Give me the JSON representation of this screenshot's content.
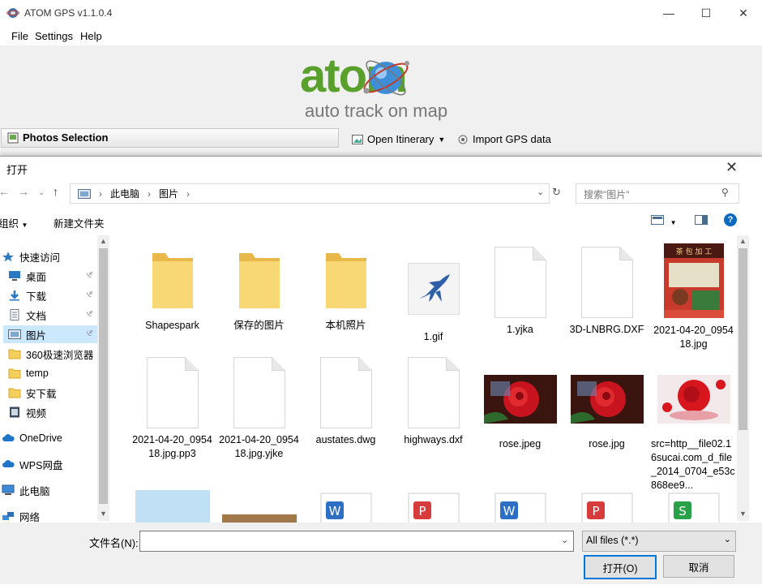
{
  "app": {
    "title": "ATOM GPS v1.1.0.4",
    "menu": [
      "File",
      "Settings",
      "Help"
    ],
    "logo_main": "atom",
    "logo_sub": "auto track on map",
    "panel_title": "Photos Selection",
    "toolbar": {
      "open_itinerary": "Open Itinerary",
      "import_gps": "Import GPS data"
    }
  },
  "dialog": {
    "title": "打开",
    "breadcrumbs": [
      "此电脑",
      "图片"
    ],
    "search_placeholder": "搜索\"图片\"",
    "organize": "组织",
    "new_folder": "新建文件夹",
    "nav": [
      {
        "label": "快速访问",
        "icon": "star-icon"
      },
      {
        "label": "桌面",
        "icon": "desktop-icon",
        "pinned": true
      },
      {
        "label": "下载",
        "icon": "download-icon",
        "pinned": true
      },
      {
        "label": "文档",
        "icon": "document-icon",
        "pinned": true
      },
      {
        "label": "图片",
        "icon": "pictures-icon",
        "pinned": true,
        "selected": true
      },
      {
        "label": "360极速浏览器",
        "icon": "folder-icon"
      },
      {
        "label": "temp",
        "icon": "folder-icon"
      },
      {
        "label": "安下载",
        "icon": "folder-icon"
      },
      {
        "label": "视频",
        "icon": "video-icon"
      },
      {
        "label": "OneDrive",
        "icon": "cloud-icon"
      },
      {
        "label": "WPS网盘",
        "icon": "cloud-icon"
      },
      {
        "label": "此电脑",
        "icon": "computer-icon"
      },
      {
        "label": "网络",
        "icon": "network-icon"
      }
    ],
    "files": [
      {
        "name": "Shapespark",
        "kind": "folder"
      },
      {
        "name": "保存的图片",
        "kind": "folder"
      },
      {
        "name": "本机照片",
        "kind": "folder"
      },
      {
        "name": "1.gif",
        "kind": "gif"
      },
      {
        "name": "1.yjka",
        "kind": "doc"
      },
      {
        "name": "3D-LNBRG.DXF",
        "kind": "doc"
      },
      {
        "name": "2021-04-20_095418.jpg",
        "kind": "photo-poster"
      },
      {
        "name": "2021-04-20_095418.jpg.pp3",
        "kind": "doc"
      },
      {
        "name": "2021-04-20_095418.jpg.yjke",
        "kind": "doc"
      },
      {
        "name": "austates.dwg",
        "kind": "doc"
      },
      {
        "name": "highways.dxf",
        "kind": "doc"
      },
      {
        "name": "rose.jpeg",
        "kind": "photo-rose"
      },
      {
        "name": "rose.jpg",
        "kind": "photo-rose"
      },
      {
        "name": "src=http__file02.16sucai.com_d_file_2014_0704_e53c868ee9...",
        "kind": "photo-rose2"
      }
    ],
    "filename_label": "文件名(N):",
    "filename_value": "",
    "filter": "All files (*.*)",
    "open_label": "打开(O)",
    "cancel_label": "取消"
  },
  "colors": {
    "logo_green": "#5aa02c",
    "selection": "#cce8ff",
    "accent": "#0078d7"
  }
}
